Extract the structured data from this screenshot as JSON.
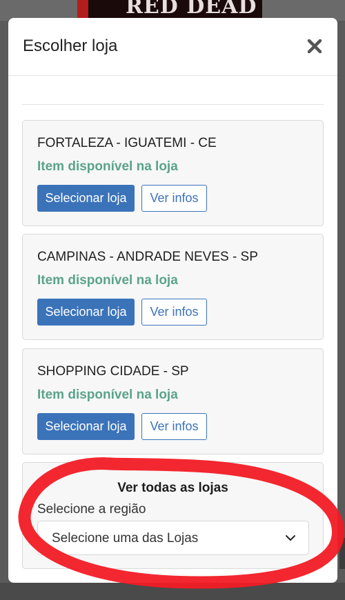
{
  "background": {
    "cover_title": "RED DEAD"
  },
  "modal": {
    "title": "Escolher loja",
    "close_icon": "close-icon"
  },
  "stores": [
    {
      "name": "FORTALEZA - IGUATEMI - CE",
      "availability": "Item disponível na loja",
      "select_label": "Selecionar loja",
      "info_label": "Ver infos"
    },
    {
      "name": "CAMPINAS - ANDRADE NEVES - SP",
      "availability": "Item disponível na loja",
      "select_label": "Selecionar loja",
      "info_label": "Ver infos"
    },
    {
      "name": "SHOPPING CIDADE - SP",
      "availability": "Item disponível na loja",
      "select_label": "Selecionar loja",
      "info_label": "Ver infos"
    }
  ],
  "all_stores": {
    "title": "Ver todas as lojas",
    "region_label": "Selecione a região",
    "select_value": "Selecione uma das Lojas",
    "select_icon": "chevron-down-icon"
  },
  "colors": {
    "primary": "#3b73b9",
    "available": "#5aa38a",
    "annotation": "#f21b24"
  }
}
